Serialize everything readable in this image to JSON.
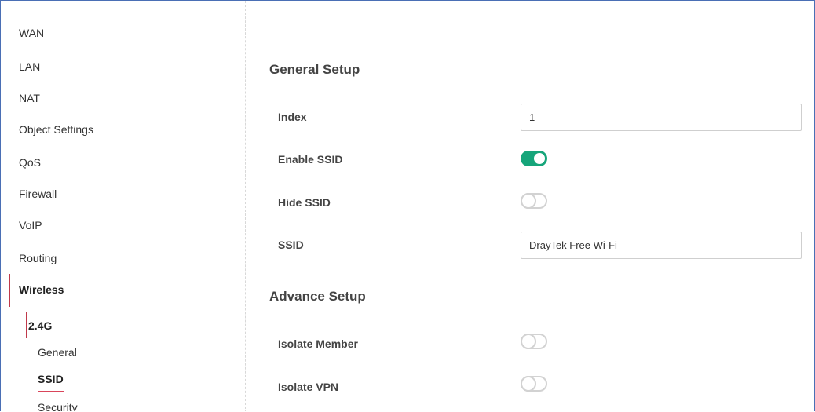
{
  "sidebar": {
    "items": [
      {
        "label": "WAN"
      },
      {
        "label": "LAN"
      },
      {
        "label": "NAT"
      },
      {
        "label": "Object Settings"
      },
      {
        "label": "QoS"
      },
      {
        "label": "Firewall"
      },
      {
        "label": "VoIP"
      },
      {
        "label": "Routing"
      },
      {
        "label": "Wireless"
      }
    ],
    "band": "2.4G",
    "sub_items": [
      {
        "label": "General"
      },
      {
        "label": "SSID"
      },
      {
        "label": "Security"
      }
    ]
  },
  "general_setup": {
    "title": "General Setup",
    "index_label": "Index",
    "index_value": "1",
    "enable_ssid_label": "Enable SSID",
    "enable_ssid_on": true,
    "hide_ssid_label": "Hide SSID",
    "hide_ssid_on": false,
    "ssid_label": "SSID",
    "ssid_value": "DrayTek Free Wi-Fi"
  },
  "advance_setup": {
    "title": "Advance Setup",
    "isolate_member_label": "Isolate Member",
    "isolate_member_on": false,
    "isolate_vpn_label": "Isolate VPN",
    "isolate_vpn_on": false
  },
  "colors": {
    "accent": "#16a57a",
    "active_marker": "#c0394a",
    "frame_border": "#4a6fb5"
  }
}
